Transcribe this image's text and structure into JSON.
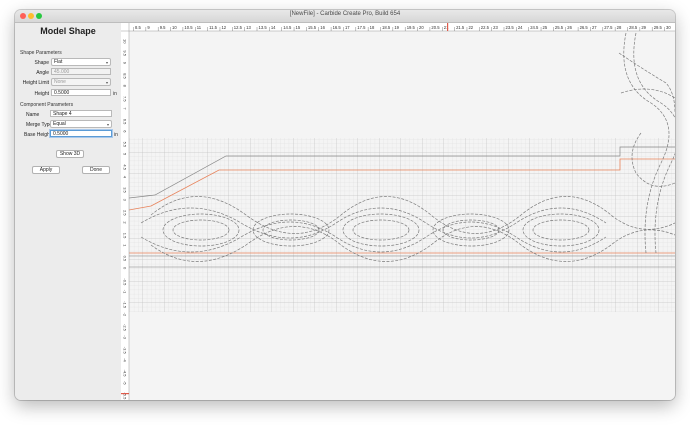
{
  "window": {
    "title": "[NewFile] - Carbide Create Pro, Build 654"
  },
  "panel": {
    "title": "Model Shape",
    "shape_params": {
      "section_label": "Shape Parameters",
      "shape_label": "Shape",
      "shape_value": "Flat",
      "angle_label": "Angle",
      "angle_value": "45.000",
      "height_limit_label": "Height Limit",
      "height_limit_value": "None",
      "height_label": "Height",
      "height_value": "0.5000",
      "height_unit": "in"
    },
    "component_params": {
      "section_label": "Component Parameters",
      "name_label": "Name",
      "name_value": "Shape 4",
      "merge_label": "Merge Type",
      "merge_value": "Equal",
      "base_label": "Base Height",
      "base_value": "0.5000",
      "base_unit": "in"
    },
    "show3d_label": "Show 3D",
    "apply_label": "Apply",
    "done_label": "Done"
  },
  "ruler": {
    "top_labels": [
      "8.5",
      "9",
      "9.5",
      "10",
      "10.5",
      "11",
      "11.5",
      "12",
      "12.5",
      "13",
      "13.5",
      "14",
      "14.5",
      "15",
      "15.5",
      "16",
      "16.5",
      "17",
      "17.5",
      "18",
      "18.5",
      "19",
      "19.5",
      "20",
      "20.5",
      "21",
      "21.5",
      "22",
      "22.5",
      "23",
      "23.5",
      "24",
      "24.5",
      "25",
      "25.5",
      "26",
      "26.5",
      "27",
      "27.5",
      "28",
      "28.5",
      "29",
      "29.5",
      "30"
    ],
    "left_labels": [
      "10",
      "9.5",
      "9",
      "8.5",
      "8",
      "7.5",
      "7",
      "6.5",
      "6",
      "5.5",
      "5",
      "4.5",
      "4",
      "3.5",
      "3",
      "2.5",
      "2",
      "1.5",
      "1",
      "0.5",
      "0",
      "-0.5",
      "-1",
      "-1.5",
      "-2",
      "-2.5",
      "-3",
      "-3.5",
      "-4",
      "-4.5",
      "-5",
      "-5.5"
    ]
  },
  "colors": {
    "accent": "#4a90d9",
    "toolpath_orange": "#e8825a",
    "ruler_marker": "#e05a4a",
    "traffic": [
      "#ff5f57",
      "#febc2e",
      "#28c840"
    ]
  }
}
